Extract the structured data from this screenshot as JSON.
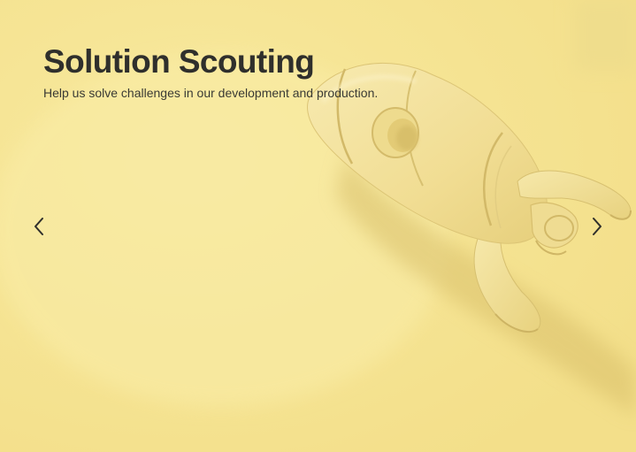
{
  "hero": {
    "title": "Solution Scouting",
    "subtitle": "Help us solve challenges in our development and production.",
    "background_image": "rocket-toy-photo",
    "tint_color": "#f7e797",
    "text_color": "#2f2f2c"
  },
  "carousel": {
    "prev_icon": "chevron-left-icon",
    "next_icon": "chevron-right-icon"
  }
}
